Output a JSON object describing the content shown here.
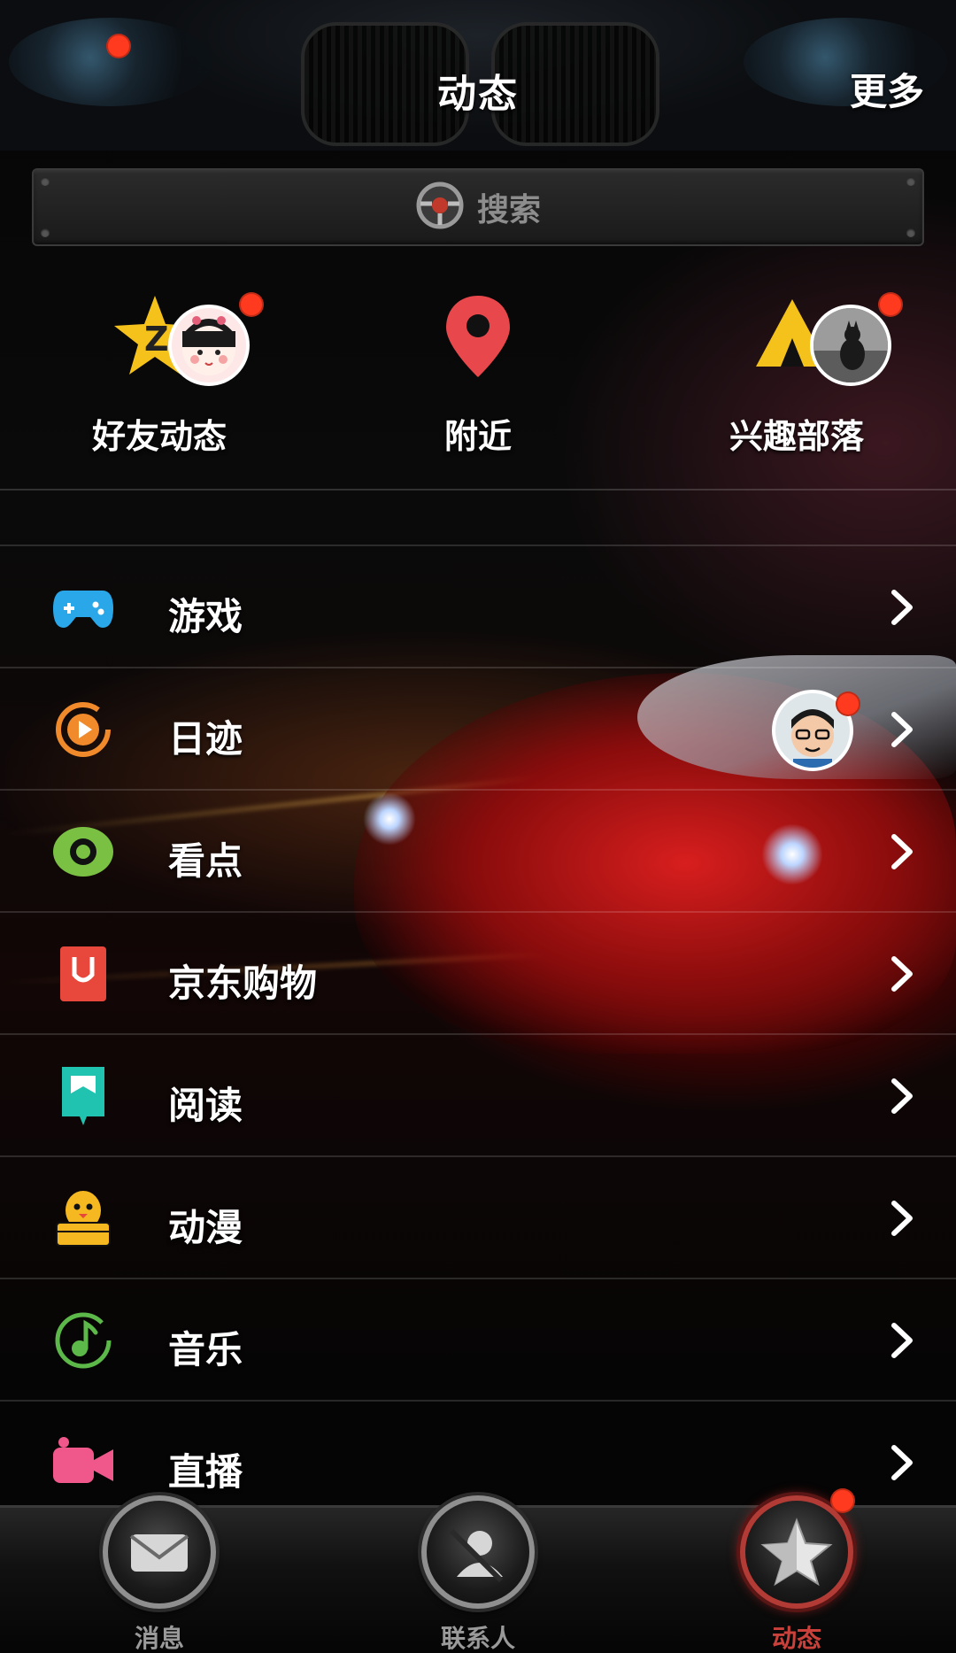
{
  "header": {
    "title": "动态",
    "more_label": "更多"
  },
  "search": {
    "label": "搜索"
  },
  "quick_entries": [
    {
      "label": "好友动态",
      "icon": "qzone-star-icon",
      "has_dot": true
    },
    {
      "label": "附近",
      "icon": "location-pin-icon",
      "has_dot": false
    },
    {
      "label": "兴趣部落",
      "icon": "tribe-tent-icon",
      "has_dot": true
    }
  ],
  "menu": [
    {
      "label": "游戏",
      "icon": "gamepad-icon",
      "color": "#2aa7e8"
    },
    {
      "label": "日迹",
      "icon": "daily-story-icon",
      "color": "#f08a2b",
      "has_avatar": true
    },
    {
      "label": "看点",
      "icon": "eye-icon",
      "color": "#7ac143"
    },
    {
      "label": "京东购物",
      "icon": "shopping-bag-icon",
      "color": "#e8473b"
    },
    {
      "label": "阅读",
      "icon": "bookmark-book-icon",
      "color": "#1fc3b0"
    },
    {
      "label": "动漫",
      "icon": "penguin-basket-icon",
      "color": "#f5b820"
    },
    {
      "label": "音乐",
      "icon": "music-note-icon",
      "color": "#5cb849"
    },
    {
      "label": "直播",
      "icon": "video-camera-icon",
      "color": "#f0578a"
    }
  ],
  "tabbar": [
    {
      "label": "消息",
      "icon": "mail-icon",
      "active": false
    },
    {
      "label": "联系人",
      "icon": "contacts-icon",
      "active": false
    },
    {
      "label": "动态",
      "icon": "star-icon",
      "active": true,
      "has_dot": true
    }
  ],
  "colors": {
    "notification_dot": "#ff3a1e",
    "active_tab": "#c9413a"
  }
}
